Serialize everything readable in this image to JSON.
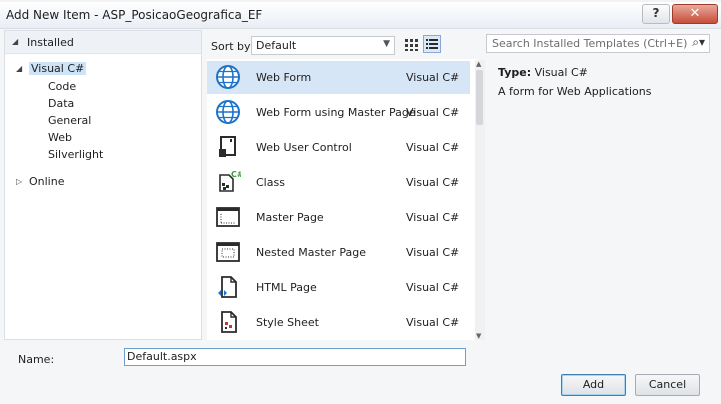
{
  "window": {
    "title": "Add New Item - ASP_PosicaoGeografica_EF",
    "help_glyph": "?",
    "close_glyph": "✕"
  },
  "tree": {
    "header": "Installed",
    "root": "Visual C#",
    "children": [
      "Code",
      "Data",
      "General",
      "Web",
      "Silverlight"
    ],
    "other": "Online"
  },
  "toolbar": {
    "sort_label": "Sort by:",
    "sort_value": "Default"
  },
  "templates": [
    {
      "name": "Web Form",
      "lang": "Visual C#",
      "icon": "globe-icon",
      "selected": true
    },
    {
      "name": "Web Form using Master Page",
      "lang": "Visual C#",
      "icon": "globe-icon",
      "selected": false
    },
    {
      "name": "Web User Control",
      "lang": "Visual C#",
      "icon": "user-control-icon",
      "selected": false
    },
    {
      "name": "Class",
      "lang": "Visual C#",
      "icon": "class-icon",
      "selected": false
    },
    {
      "name": "Master Page",
      "lang": "Visual C#",
      "icon": "master-page-icon",
      "selected": false
    },
    {
      "name": "Nested Master Page",
      "lang": "Visual C#",
      "icon": "nested-master-page-icon",
      "selected": false
    },
    {
      "name": "HTML Page",
      "lang": "Visual C#",
      "icon": "html-page-icon",
      "selected": false
    },
    {
      "name": "Style Sheet",
      "lang": "Visual C#",
      "icon": "style-sheet-icon",
      "selected": false
    }
  ],
  "search": {
    "placeholder": "Search Installed Templates (Ctrl+E)"
  },
  "details": {
    "type_label": "Type:",
    "type_value": "Visual C#",
    "description": "A form for Web Applications"
  },
  "footer": {
    "name_label": "Name:",
    "name_value": "Default.aspx",
    "add_label": "Add",
    "cancel_label": "Cancel"
  },
  "colors": {
    "selection": "#d7e6f7",
    "accent": "#1e73c8"
  }
}
